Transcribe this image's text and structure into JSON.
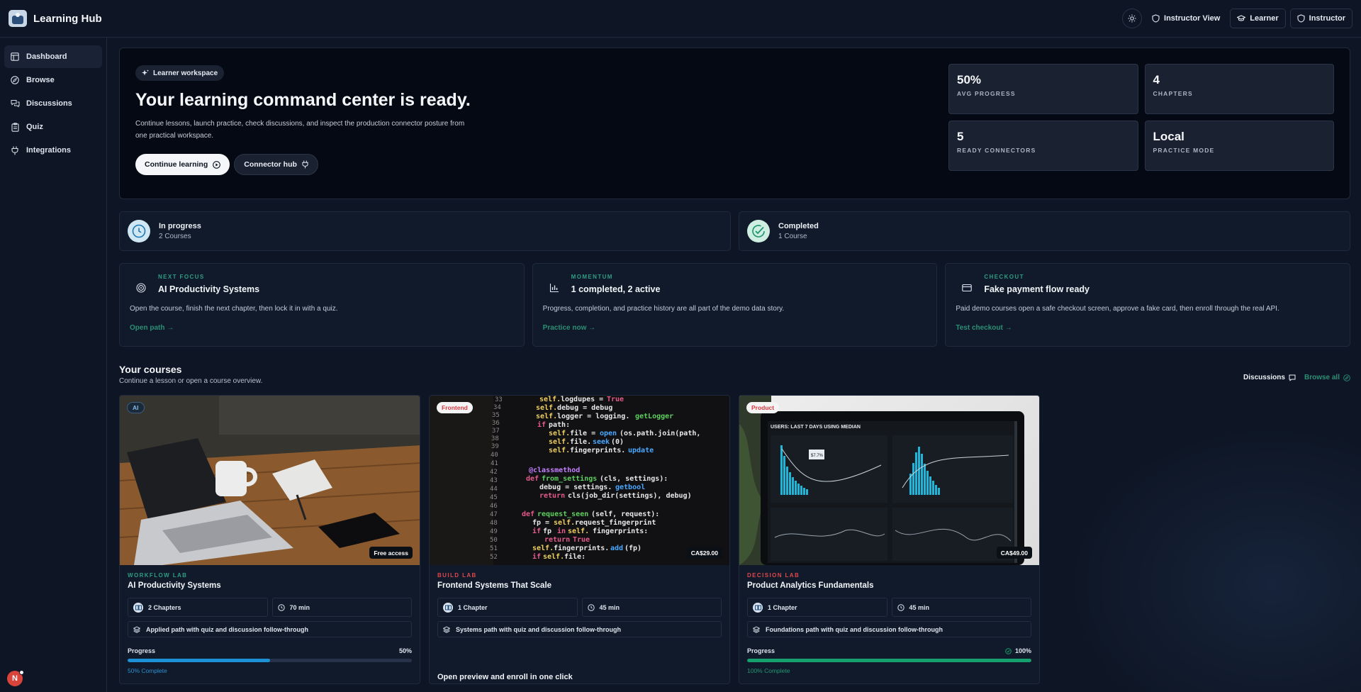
{
  "app": {
    "name": "Learning Hub"
  },
  "topbar": {
    "instructor_view": "Instructor View",
    "learner": "Learner",
    "instructor": "Instructor"
  },
  "sidebar": {
    "items": [
      {
        "label": "Dashboard",
        "icon": "layout-icon",
        "active": true
      },
      {
        "label": "Browse",
        "icon": "compass-icon"
      },
      {
        "label": "Discussions",
        "icon": "chat-icon"
      },
      {
        "label": "Quiz",
        "icon": "clipboard-icon"
      },
      {
        "label": "Integrations",
        "icon": "plug-icon"
      }
    ],
    "avatar_initial": "N"
  },
  "hero": {
    "pill": "Learner workspace",
    "title": "Your learning command center is ready.",
    "description": "Continue lessons, launch practice, check discussions, and inspect the production connector posture from one practical workspace.",
    "primary": "Continue learning",
    "secondary": "Connector hub",
    "stats": [
      {
        "value": "50%",
        "label": "AVG PROGRESS"
      },
      {
        "value": "4",
        "label": "CHAPTERS"
      },
      {
        "value": "5",
        "label": "READY CONNECTORS"
      },
      {
        "value": "Local",
        "label": "PRACTICE MODE"
      }
    ]
  },
  "status": [
    {
      "title": "In progress",
      "sub": "2 Courses",
      "icon": "clock-icon"
    },
    {
      "title": "Completed",
      "sub": "1 Course",
      "icon": "check-circle-icon"
    }
  ],
  "focus": [
    {
      "eyebrow": "NEXT FOCUS",
      "title": "AI Productivity Systems",
      "desc": "Open the course, finish the next chapter, then lock it in with a quiz.",
      "link": "Open path →",
      "icon": "target-icon"
    },
    {
      "eyebrow": "MOMENTUM",
      "title": "1 completed, 2 active",
      "desc": "Progress, completion, and practice history are all part of the demo data story.",
      "link": "Practice now →",
      "icon": "bar-chart-icon"
    },
    {
      "eyebrow": "CHECKOUT",
      "title": "Fake payment flow ready",
      "desc": "Paid demo courses open a safe checkout screen, approve a fake card, then enroll through the real API.",
      "link": "Test checkout →",
      "icon": "credit-card-icon"
    }
  ],
  "courses_section": {
    "title": "Your courses",
    "subtitle": "Continue a lesson or open a course overview.",
    "discussions": "Discussions",
    "browse_all": "Browse all"
  },
  "courses": [
    {
      "tag": "AI",
      "badge": "Free access",
      "eyebrow": "WORKFLOW LAB",
      "eyebrow_color": "#2f9d83",
      "title": "AI Productivity Systems",
      "chapters": "2 Chapters",
      "duration": "70 min",
      "path": "Applied path with quiz and discussion follow-through",
      "progress_label": "Progress",
      "progress_value": "50%",
      "progress": 0.5,
      "progress_color": "#1e90d6",
      "foot": "50% Complete",
      "foot_color": "#2b8fd0"
    },
    {
      "tag": "Frontend",
      "badge": "CA$29.00",
      "eyebrow": "BUILD LAB",
      "eyebrow_color": "#e0474c",
      "title": "Frontend Systems That Scale",
      "chapters": "1 Chapter",
      "duration": "45 min",
      "path": "Systems path with quiz and discussion follow-through",
      "enroll": "Open preview and enroll in one click"
    },
    {
      "tag": "Product",
      "badge": "CA$49.00",
      "eyebrow": "DECISION LAB",
      "eyebrow_color": "#e0474c",
      "title": "Product Analytics Fundamentals",
      "chapters": "1 Chapter",
      "duration": "45 min",
      "path": "Foundations path with quiz and discussion follow-through",
      "progress_label": "Progress",
      "progress_value": "100%",
      "progress": 1.0,
      "progress_color": "#16a06e",
      "foot": "100% Complete",
      "foot_color": "#1f9a73"
    }
  ],
  "dashboard_screen": {
    "header": "USERS: LAST 7 DAYS USING MEDIAN",
    "callout": "$7.7%"
  }
}
